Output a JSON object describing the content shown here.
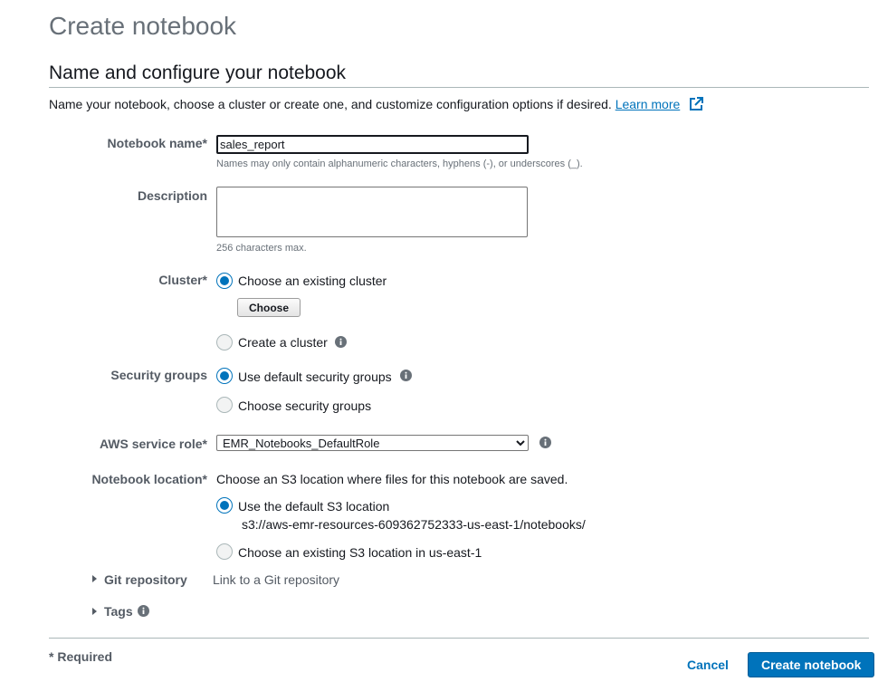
{
  "page": {
    "title": "Create notebook"
  },
  "section": {
    "title": "Name and configure your notebook",
    "description": "Name your notebook, choose a cluster or create one, and customize configuration options if desired.",
    "learn_more": "Learn more"
  },
  "notebook_name": {
    "label": "Notebook name*",
    "value": "sales_report",
    "hint": "Names may only contain alphanumeric characters, hyphens (-), or underscores (_)."
  },
  "description": {
    "label": "Description",
    "value": "",
    "hint": "256 characters max."
  },
  "cluster": {
    "label": "Cluster*",
    "option_existing": "Choose an existing cluster",
    "choose_button": "Choose",
    "option_create": "Create a cluster",
    "selected": "existing"
  },
  "security_groups": {
    "label": "Security groups",
    "option_default": "Use default security groups",
    "option_choose": "Choose security groups",
    "selected": "default"
  },
  "service_role": {
    "label": "AWS service role*",
    "selected": "EMR_Notebooks_DefaultRole",
    "options": [
      "EMR_Notebooks_DefaultRole"
    ]
  },
  "notebook_location": {
    "label": "Notebook location*",
    "description": "Choose an S3 location where files for this notebook are saved.",
    "option_default": "Use the default S3 location",
    "default_path": "s3://aws-emr-resources-609362752333-us-east-1/notebooks/",
    "option_existing": "Choose an existing S3 location in us-east-1",
    "selected": "default"
  },
  "git_repository": {
    "label": "Git repository",
    "description": "Link to a Git repository"
  },
  "tags": {
    "label": "Tags"
  },
  "footer": {
    "required_note": "* Required",
    "cancel": "Cancel",
    "submit": "Create notebook"
  },
  "colors": {
    "accent": "#0073bb",
    "label": "#545b64",
    "text": "#16191f",
    "muted": "#687078"
  },
  "icons": {
    "info": "info-icon",
    "external": "external-link-icon",
    "caret": "caret-right-icon"
  }
}
